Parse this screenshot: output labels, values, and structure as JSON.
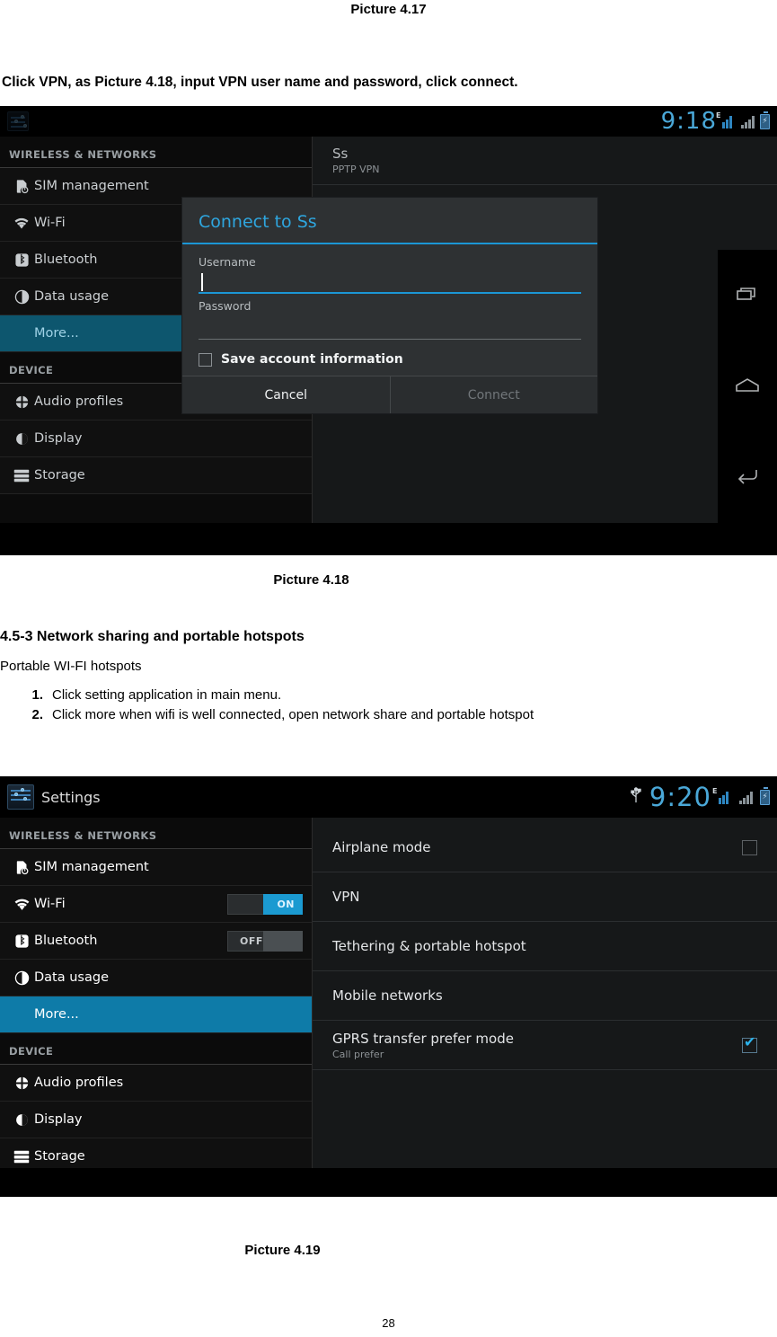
{
  "document": {
    "caption_top": "Picture 4.17",
    "intro_line": "Click VPN, as Picture 4.18, input VPN user name and password, click connect.",
    "caption_418": "Picture 4.18",
    "section_heading": "4.5-3 Network sharing and portable hotspots",
    "section_subtitle": "Portable WI-FI hotspots",
    "steps": [
      {
        "num": "1.",
        "text": "Click setting application in main menu."
      },
      {
        "num": "2.",
        "text": "Click more when wifi is well connected, open network share and portable hotspot"
      }
    ],
    "caption_419": "Picture 4.19",
    "page_number": "28"
  },
  "screenshot_418": {
    "statusbar": {
      "app_title": "",
      "clock": "9:18",
      "signal_badge": "E",
      "icons": [
        "signal-bars-icon",
        "signal-bars-grey-icon",
        "battery-charging-icon"
      ]
    },
    "sidebar": {
      "sections": [
        {
          "header": "WIRELESS & NETWORKS",
          "items": [
            {
              "label": "SIM management",
              "icon": "sim-card-icon",
              "selected": false,
              "toggle": null
            },
            {
              "label": "Wi-Fi",
              "icon": "wifi-icon",
              "selected": false,
              "toggle": null
            },
            {
              "label": "Bluetooth",
              "icon": "bluetooth-icon",
              "selected": false,
              "toggle": null
            },
            {
              "label": "Data usage",
              "icon": "data-usage-icon",
              "selected": false,
              "toggle": null
            },
            {
              "label": "More...",
              "icon": null,
              "selected": true,
              "toggle": null
            }
          ]
        },
        {
          "header": "DEVICE",
          "items": [
            {
              "label": "Audio profiles",
              "icon": "audio-profiles-icon",
              "selected": false,
              "toggle": null
            },
            {
              "label": "Display",
              "icon": "display-icon",
              "selected": false,
              "toggle": null
            },
            {
              "label": "Storage",
              "icon": "storage-icon",
              "selected": false,
              "toggle": null
            }
          ]
        }
      ]
    },
    "content": {
      "vpn_entry": {
        "title": "Ss",
        "subtitle": "PPTP VPN"
      }
    },
    "dialog": {
      "title": "Connect to Ss",
      "username_label": "Username",
      "username_value": "",
      "password_label": "Password",
      "password_value": "",
      "save_checkbox_label": "Save account information",
      "save_checked": false,
      "cancel_label": "Cancel",
      "connect_label": "Connect",
      "connect_enabled": false,
      "accent_color": "#1b96d5"
    },
    "navbar": {
      "buttons": [
        "recent-apps-icon",
        "home-icon",
        "back-icon"
      ]
    }
  },
  "screenshot_419": {
    "statusbar": {
      "app_title": "Settings",
      "clock": "9:20",
      "signal_badge": "E",
      "icons": [
        "usb-icon",
        "signal-bars-icon",
        "signal-bars-grey-icon",
        "battery-charging-icon"
      ]
    },
    "sidebar": {
      "sections": [
        {
          "header": "WIRELESS & NETWORKS",
          "items": [
            {
              "label": "SIM management",
              "icon": "sim-card-icon",
              "selected": false,
              "toggle": null
            },
            {
              "label": "Wi-Fi",
              "icon": "wifi-icon",
              "selected": false,
              "toggle": {
                "state": "ON",
                "label": "ON"
              }
            },
            {
              "label": "Bluetooth",
              "icon": "bluetooth-icon",
              "selected": false,
              "toggle": {
                "state": "OFF",
                "label": "OFF"
              }
            },
            {
              "label": "Data usage",
              "icon": "data-usage-icon",
              "selected": false,
              "toggle": null
            },
            {
              "label": "More...",
              "icon": null,
              "selected": true,
              "toggle": null
            }
          ]
        },
        {
          "header": "DEVICE",
          "items": [
            {
              "label": "Audio profiles",
              "icon": "audio-profiles-icon",
              "selected": false,
              "toggle": null
            },
            {
              "label": "Display",
              "icon": "display-icon",
              "selected": false,
              "toggle": null
            },
            {
              "label": "Storage",
              "icon": "storage-icon",
              "selected": false,
              "toggle": null
            }
          ]
        }
      ]
    },
    "content": {
      "rows": [
        {
          "title": "Airplane mode",
          "subtitle": "",
          "control": "checkbox",
          "checked": false
        },
        {
          "title": "VPN",
          "subtitle": "",
          "control": "none",
          "checked": false
        },
        {
          "title": "Tethering & portable hotspot",
          "subtitle": "",
          "control": "none",
          "checked": false
        },
        {
          "title": "Mobile networks",
          "subtitle": "",
          "control": "none",
          "checked": false
        },
        {
          "title": "GPRS transfer prefer mode",
          "subtitle": "Call prefer",
          "control": "checkbox",
          "checked": true
        }
      ]
    }
  },
  "theme": {
    "accent_blue": "#1b9ad1",
    "title_blue": "#2ea6df",
    "clock_blue": "#4aa8d8",
    "selected_row": "#0e7ba8"
  }
}
